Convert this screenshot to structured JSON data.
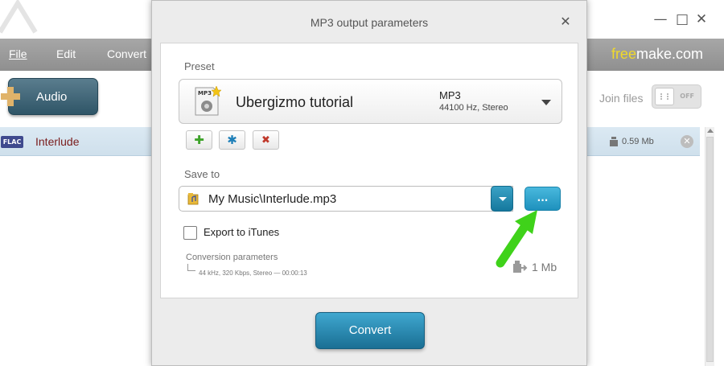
{
  "app": {
    "window_controls": {
      "minimize": "—",
      "maximize": "□",
      "close": "✕"
    },
    "menu": {
      "file": "File",
      "edit": "Edit",
      "convert": "Convert"
    },
    "brand": {
      "prefix": "free",
      "suffix": "make.com",
      "accent_color": "#f0d92a"
    },
    "toolbar": {
      "audio_label": "Audio",
      "join_files_label": "Join files",
      "join_toggle_state": "OFF"
    },
    "file_row": {
      "format_badge": "FLAC",
      "name": "Interlude",
      "size": "0.59 Mb",
      "remove_glyph": "✕"
    }
  },
  "dialog": {
    "title": "MP3 output parameters",
    "close_glyph": "✕",
    "preset": {
      "label": "Preset",
      "icon_badge": "MP3",
      "name": "Ubergizmo tutorial",
      "format": "MP3",
      "details": "44100 Hz,  Stereo"
    },
    "preset_actions": {
      "add": "✚",
      "edit": "✱",
      "delete": "✖"
    },
    "save_to": {
      "label": "Save to",
      "path": "My Music\\Interlude.mp3",
      "browse_label": "..."
    },
    "export_itunes": {
      "label": "Export to iTunes",
      "checked": false
    },
    "conversion": {
      "label": "Conversion parameters",
      "value": "44 kHz, 320 Kbps, Stereo — 00:00:13",
      "size": "1 Mb"
    },
    "convert_label": "Convert"
  },
  "colors": {
    "accent_blue": "#1e91bd",
    "arrow_green": "#3fd21a",
    "menubar": "#9b9b9b"
  }
}
